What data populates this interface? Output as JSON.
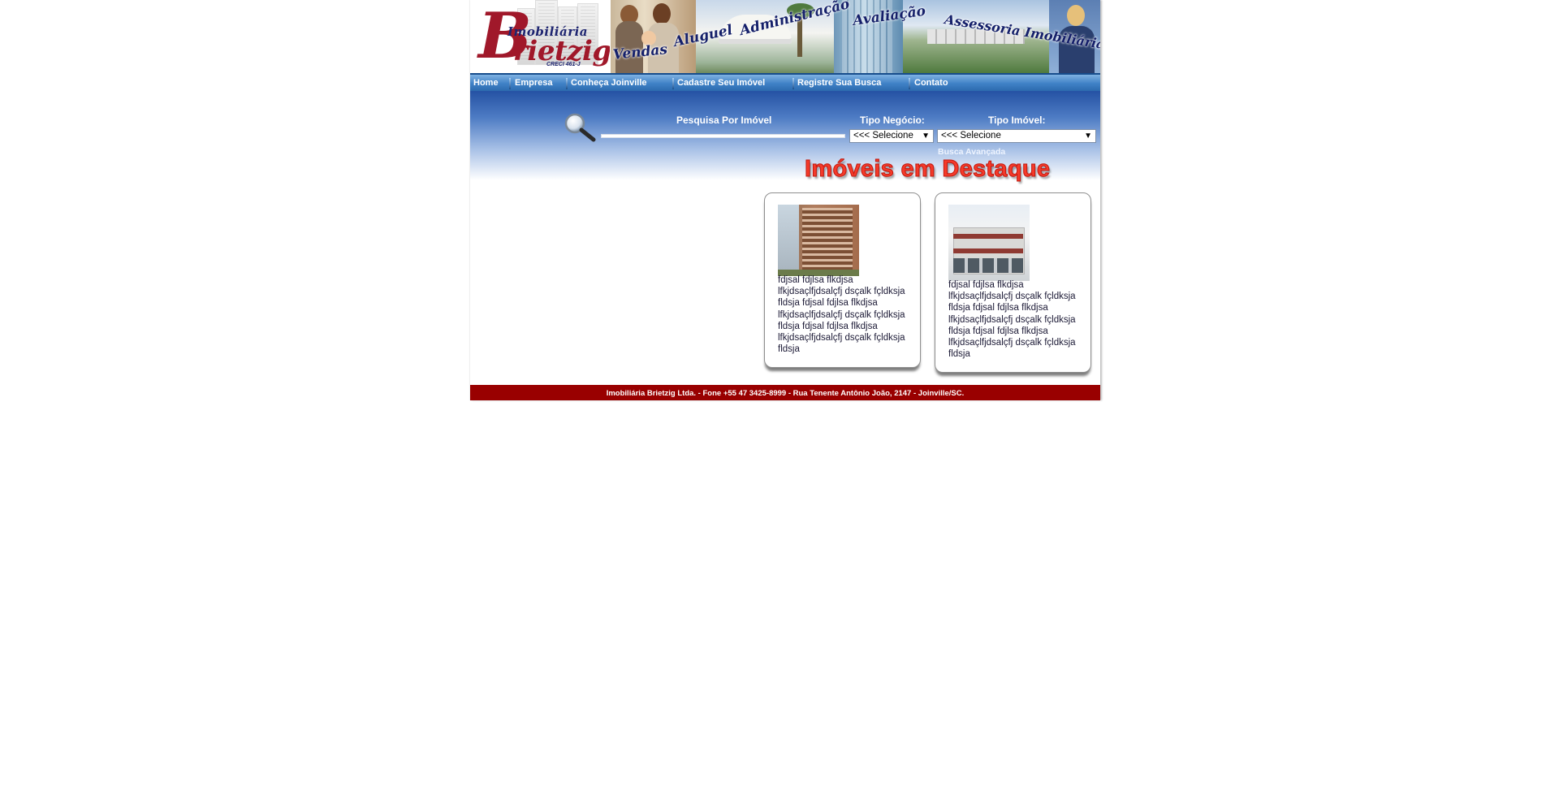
{
  "logo": {
    "initial": "B",
    "line1": "Imobiliária",
    "line2": "rietzig",
    "creci": "CRECI 461-J"
  },
  "banner": {
    "words": [
      "Vendas",
      "Aluguel",
      "Administração",
      "Avaliação",
      "Assessoria Imobiliária"
    ]
  },
  "nav": {
    "items": [
      {
        "label": "Home"
      },
      {
        "label": "Empresa"
      },
      {
        "label": "Conheça Joinville"
      },
      {
        "label": "Cadastre Seu Imóvel"
      },
      {
        "label": "Registre Sua Busca"
      },
      {
        "label": "Contato"
      }
    ]
  },
  "search": {
    "title": "Pesquisa Por Imóvel",
    "input_value": "",
    "tipo_negocio_label": "Tipo Negócio:",
    "tipo_negocio_selected": "<<< Selecione",
    "tipo_imovel_label": "Tipo Imóvel:",
    "tipo_imovel_selected": "<<< Selecione",
    "advanced_link": "Busca Avançada"
  },
  "featured": {
    "title": "Imóveis em Destaque",
    "cards": [
      {
        "text": "fdjsal fdjlsa flkdjsa lfkjdsaçlfjdsalçfj dsçalk fçldksja fldsja fdjsal fdjlsa flkdjsa lfkjdsaçlfjdsalçfj dsçalk fçldksja fldsja fdjsal fdjlsa flkdjsa lfkjdsaçlfjdsalçfj dsçalk fçldksja fldsja"
      },
      {
        "text": "fdjsal fdjlsa flkdjsa lfkjdsaçlfjdsalçfj dsçalk fçldksja fldsja fdjsal fdjlsa flkdjsa lfkjdsaçlfjdsalçfj dsçalk fçldksja fldsja fdjsal fdjlsa flkdjsa lfkjdsaçlfjdsalçfj dsçalk fçldksja fldsja"
      }
    ]
  },
  "footer": {
    "text": "Imobiliária Brietzig Ltda. - Fone +55 47 3425-8999 - Rua Tenente Antônio João, 2147 - Joinville/SC."
  },
  "colors": {
    "nav_blue": "#3f81c6",
    "footer_red": "#990000",
    "brand_red": "#a0182a",
    "brand_navy": "#1d2470",
    "title_red": "#f53a2a"
  }
}
